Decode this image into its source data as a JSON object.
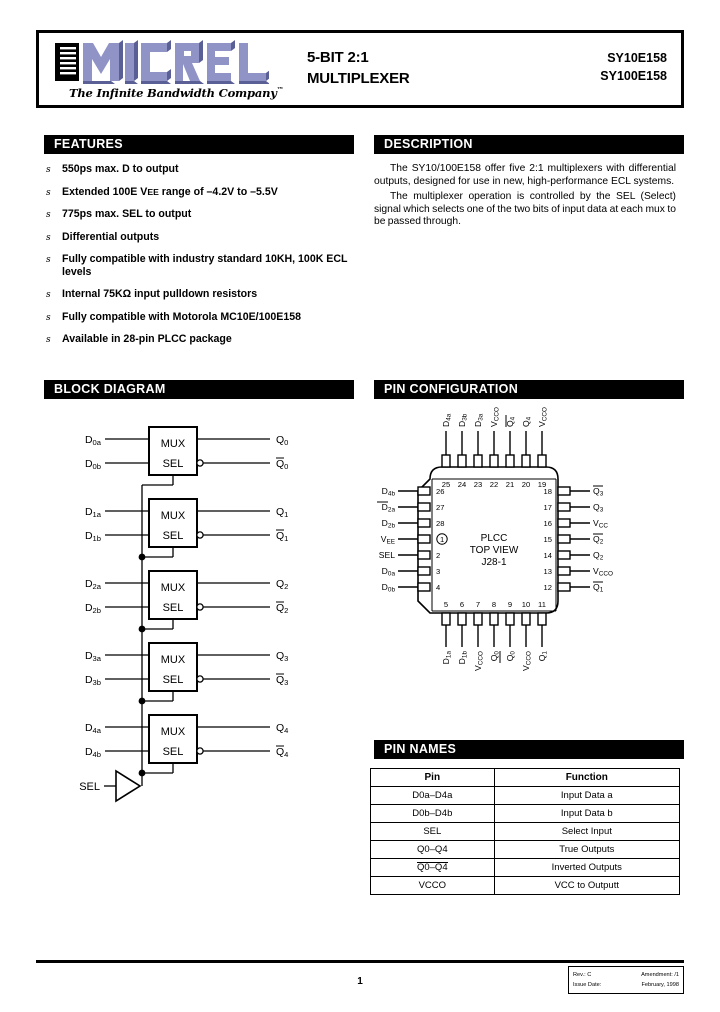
{
  "header": {
    "logo_text": "MICREL",
    "tagline": "The Infinite Bandwidth Company",
    "tagline_mark": "™",
    "title_line1": "5-BIT 2:1",
    "title_line2": "MULTIPLEXER",
    "part1": "SY10E158",
    "part2": "SY100E158",
    "logo_color": "#8f93c6",
    "logo_shadow": "#5a5f96"
  },
  "sections": {
    "features": "FEATURES",
    "description": "DESCRIPTION",
    "block_diagram": "BLOCK DIAGRAM",
    "pin_configuration": "PIN CONFIGURATION",
    "pin_names": "PIN NAMES"
  },
  "features": [
    "550ps max. D to output",
    "Extended 100E VEE range of –4.2V to –5.5V",
    "775ps max. SEL to output",
    "Differential outputs",
    "Fully compatible with industry standard 10KH, 100K ECL levels",
    "Internal 75KΩ input pulldown resistors",
    "Fully compatible with Motorola MC10E/100E158",
    "Available in 28-pin PLCC package"
  ],
  "description": {
    "para1": "The SY10/100E158 offer five 2:1 multiplexers with differential outputs, designed for use in new, high-performance ECL systems.",
    "para2": "The multiplexer operation is controlled by the SEL (Select) signal which selects one of the two bits of input data at each mux to be passed through."
  },
  "block_diagram": {
    "mux_label": "MUX",
    "sel_label": "SEL",
    "sel_input": "SEL",
    "stages": [
      {
        "in_a": "D0a",
        "in_b": "D0b",
        "out_true": "Q0",
        "out_inv": "Q0"
      },
      {
        "in_a": "D1a",
        "in_b": "D1b",
        "out_true": "Q1",
        "out_inv": "Q1"
      },
      {
        "in_a": "D2a",
        "in_b": "D2b",
        "out_true": "Q2",
        "out_inv": "Q2"
      },
      {
        "in_a": "D3a",
        "in_b": "D3b",
        "out_true": "Q3",
        "out_inv": "Q3"
      },
      {
        "in_a": "D4a",
        "in_b": "D4b",
        "out_true": "Q4",
        "out_inv": "Q4"
      }
    ]
  },
  "pin_configuration": {
    "center_line1": "PLCC",
    "center_line2": "TOP VIEW",
    "center_line3": "J28-1",
    "top_pins": [
      {
        "num": "25",
        "label": "D4a",
        "inv": false
      },
      {
        "num": "24",
        "label": "D3b",
        "inv": false
      },
      {
        "num": "23",
        "label": "D3a",
        "inv": false
      },
      {
        "num": "22",
        "label": "VCCO",
        "inv": false
      },
      {
        "num": "21",
        "label": "Q4",
        "inv": true
      },
      {
        "num": "20",
        "label": "Q4",
        "inv": false
      },
      {
        "num": "19",
        "label": "VCCO",
        "inv": false
      }
    ],
    "left_pins": [
      {
        "num": "26",
        "label": "D4b",
        "inv": false
      },
      {
        "num": "27",
        "label": "D2a",
        "inv": false
      },
      {
        "num": "28",
        "label": "D2b",
        "inv": false
      },
      {
        "num": "1",
        "label": "VEE",
        "inv": false
      },
      {
        "num": "2",
        "label": "SEL",
        "inv": false
      },
      {
        "num": "3",
        "label": "D0a",
        "inv": false
      },
      {
        "num": "4",
        "label": "D0b",
        "inv": false
      }
    ],
    "bottom_pins": [
      {
        "num": "5",
        "label": "D1a",
        "inv": false
      },
      {
        "num": "6",
        "label": "D1b",
        "inv": false
      },
      {
        "num": "7",
        "label": "VCCO",
        "inv": false
      },
      {
        "num": "8",
        "label": "Q0",
        "inv": true
      },
      {
        "num": "9",
        "label": "Q0",
        "inv": false
      },
      {
        "num": "10",
        "label": "VCCO",
        "inv": false
      },
      {
        "num": "11",
        "label": "Q1",
        "inv": false
      }
    ],
    "right_pins": [
      {
        "num": "18",
        "label": "Q3",
        "inv": true
      },
      {
        "num": "17",
        "label": "Q3",
        "inv": false
      },
      {
        "num": "16",
        "label": "VCC",
        "inv": false
      },
      {
        "num": "15",
        "label": "Q2",
        "inv": true
      },
      {
        "num": "14",
        "label": "Q2",
        "inv": false
      },
      {
        "num": "13",
        "label": "VCCO",
        "inv": false
      },
      {
        "num": "12",
        "label": "Q1",
        "inv": true
      }
    ]
  },
  "pin_names_table": {
    "headers": [
      "Pin",
      "Function"
    ],
    "rows": [
      {
        "pin": "D0a–D4a",
        "pin_overline": false,
        "function": "Input Data a"
      },
      {
        "pin": "D0b–D4b",
        "pin_overline": false,
        "function": "Input Data b"
      },
      {
        "pin": "SEL",
        "pin_overline": false,
        "function": "Select Input"
      },
      {
        "pin": "Q0–Q4",
        "pin_overline": false,
        "function": "True Outputs"
      },
      {
        "pin": "Q0–Q4",
        "pin_overline": true,
        "function": "Inverted Outputs"
      },
      {
        "pin": "VCCO",
        "pin_overline": false,
        "function": "VCC to Outputt"
      }
    ]
  },
  "footer": {
    "page_number": "1",
    "rev_label": "Rev.: C",
    "amendment_label": "Amendment: /1",
    "issue_date_label": "Issue Date:",
    "issue_date_value": "February, 1998"
  }
}
